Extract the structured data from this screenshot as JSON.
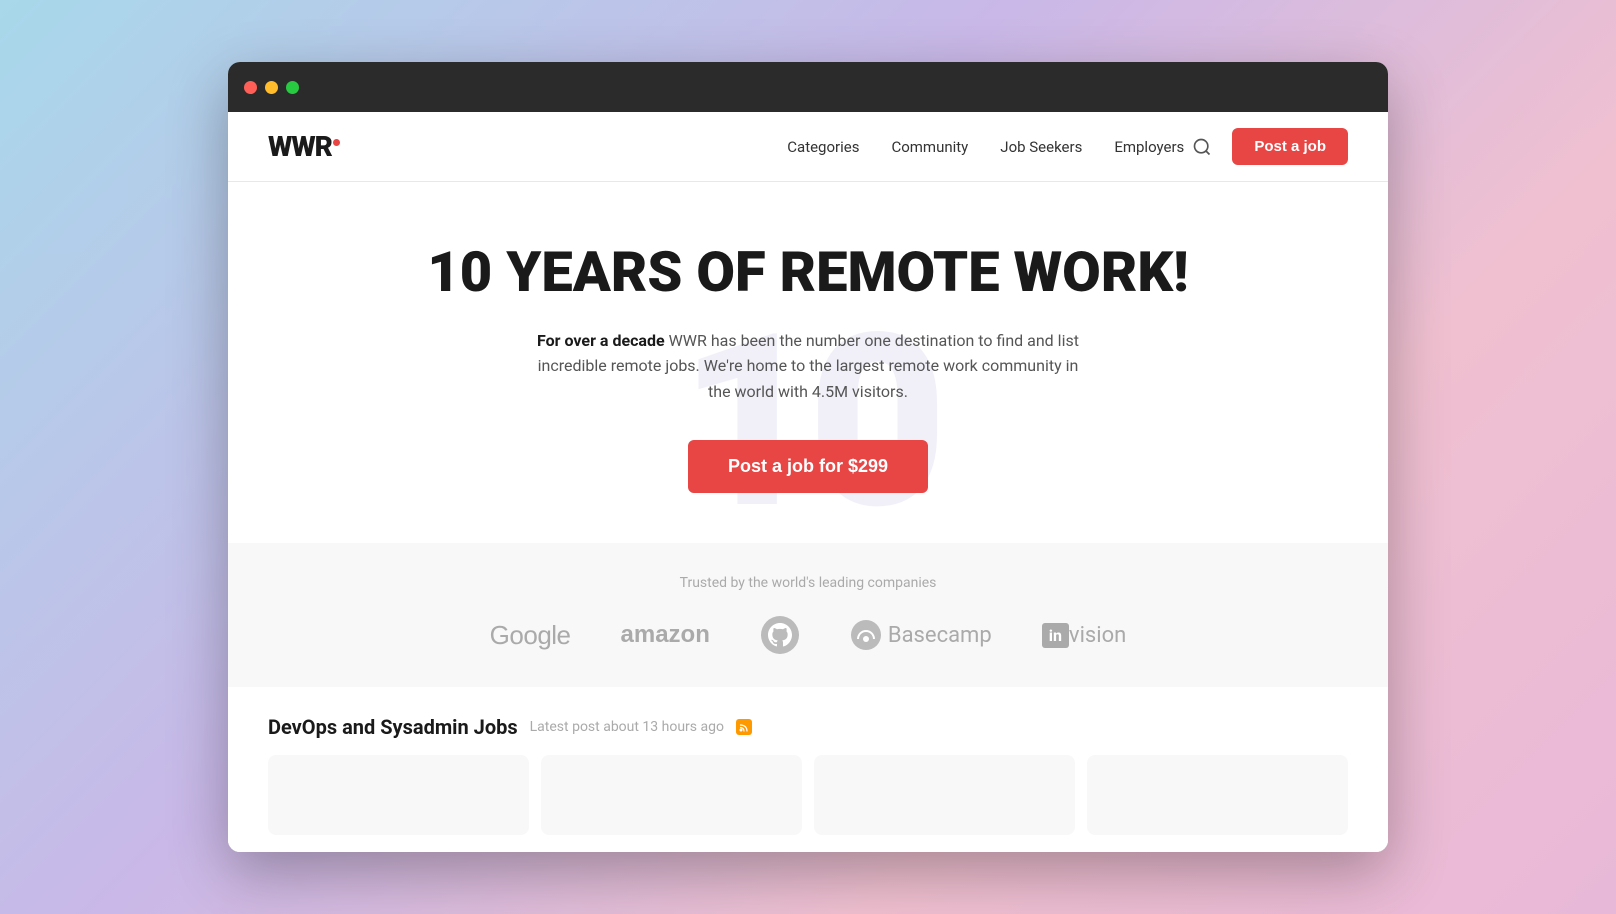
{
  "browser": {
    "traffic_lights": {
      "close": "close",
      "minimize": "minimize",
      "maximize": "maximize"
    }
  },
  "navbar": {
    "logo": "WWR",
    "nav_items": [
      {
        "label": "Categories",
        "href": "#"
      },
      {
        "label": "Community",
        "href": "#"
      },
      {
        "label": "Job Seekers",
        "href": "#"
      },
      {
        "label": "Employers",
        "href": "#"
      }
    ],
    "post_job_button": "Post a job"
  },
  "hero": {
    "title": "10 YEARS OF REMOTE WORK!",
    "subtitle_bold": "For over a decade",
    "subtitle_rest": " WWR has been the number one destination to find and list incredible remote jobs. We're home to the largest remote work community in the world with 4.5M visitors.",
    "cta_button": "Post a job for $299",
    "bg_text": "10"
  },
  "trusted": {
    "label": "Trusted by the world's leading companies",
    "companies": [
      {
        "name": "Google"
      },
      {
        "name": "amazon"
      },
      {
        "name": "GitHub"
      },
      {
        "name": "Basecamp"
      },
      {
        "name": "InVision"
      }
    ]
  },
  "jobs_section": {
    "title": "DevOps and Sysadmin Jobs",
    "meta": "Latest post about 13 hours ago",
    "rss_label": "RSS"
  }
}
